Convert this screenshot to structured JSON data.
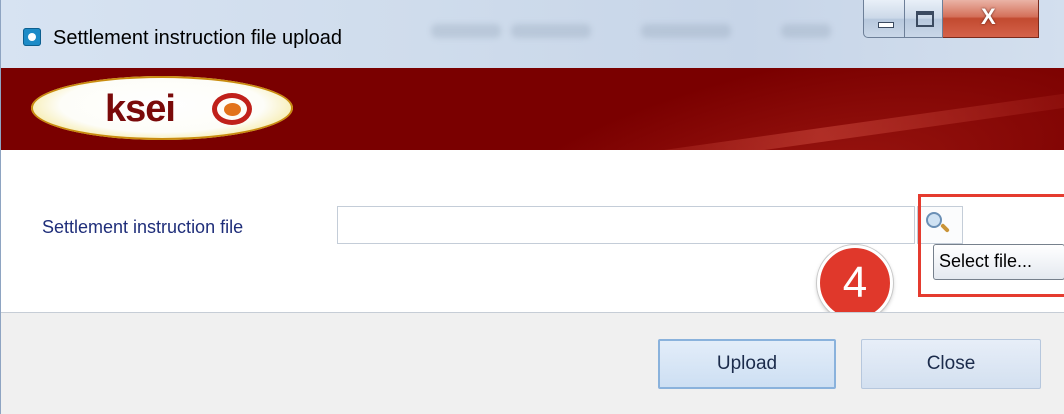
{
  "window": {
    "title": "Settlement instruction file upload",
    "controls": {
      "minimize_icon": "minimize-icon",
      "maximize_icon": "maximize-icon",
      "close_glyph": "X"
    }
  },
  "banner": {
    "logo_text": "ksei",
    "colors": {
      "banner": "#7a0000",
      "logo_ring": "#e8b21c",
      "logo_text": "#7a0a0a"
    }
  },
  "form": {
    "file_label": "Settlement instruction file",
    "file_value": "",
    "browse_icon": "magnifier-icon",
    "tooltip": "Select file..."
  },
  "annotation": {
    "step_number": "4",
    "color": "#e53b2f"
  },
  "buttons": {
    "upload_label": "Upload",
    "close_label": "Close"
  }
}
